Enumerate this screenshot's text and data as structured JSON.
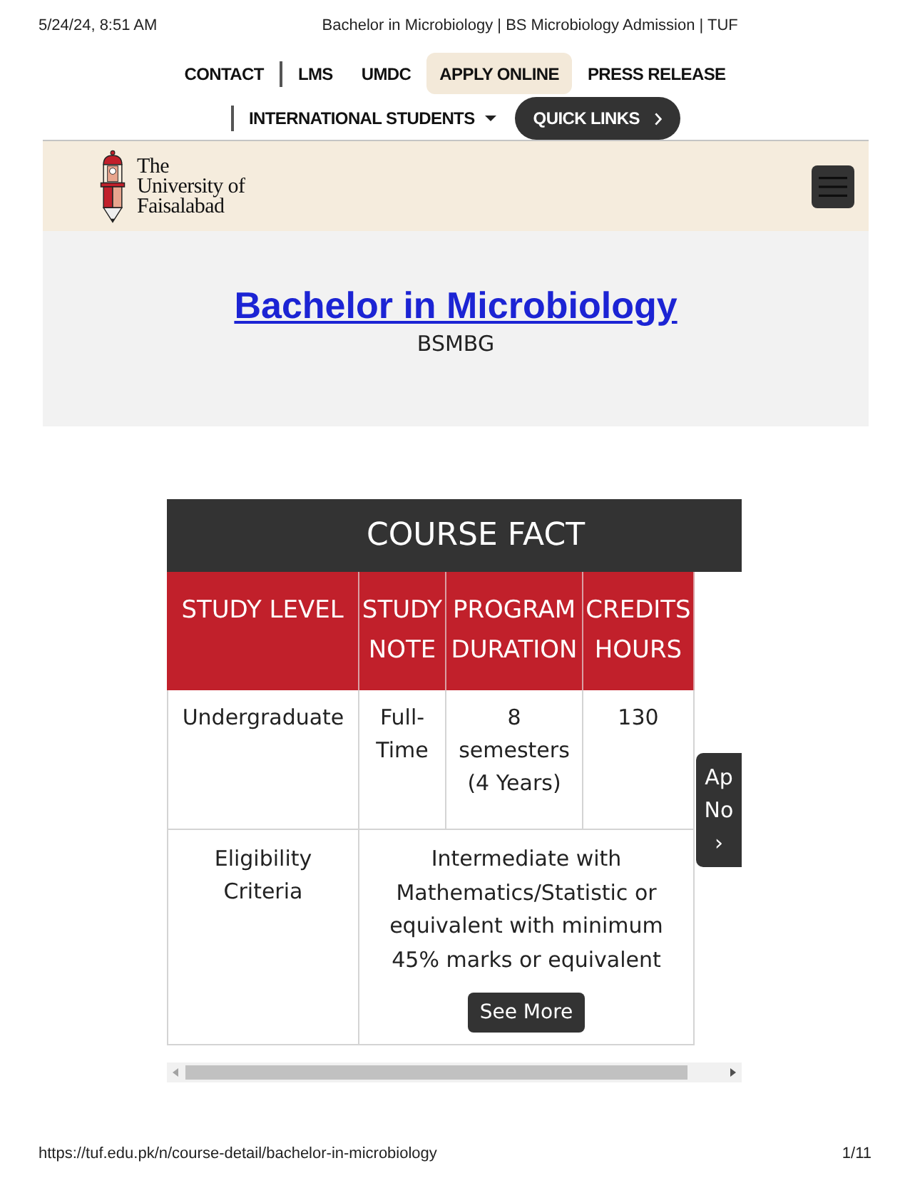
{
  "print_header": {
    "date": "5/24/24, 8:51 AM",
    "title": "Bachelor in Microbiology | BS Microbiology Admission | TUF"
  },
  "nav": {
    "row_1": [
      {
        "label": "CONTACT",
        "separated": false,
        "highlighted": false
      },
      {
        "label": "LMS",
        "separated": true,
        "highlighted": false
      },
      {
        "label": "UMDC",
        "separated": false,
        "highlighted": false
      },
      {
        "label": "APPLY ONLINE",
        "separated": false,
        "highlighted": true
      },
      {
        "label": "PRESS RELEASE",
        "separated": false,
        "highlighted": false
      }
    ],
    "row_2": [
      {
        "label": "INTERNATIONAL STUDENTS",
        "kind": "dropdown",
        "separated": true
      },
      {
        "label": "QUICK LINKS",
        "kind": "pill",
        "separated": false
      }
    ]
  },
  "header": {
    "logo_text": "The University of Faisalabad"
  },
  "hero": {
    "title": "Bachelor in Microbiology",
    "code": "BSMBG"
  },
  "course_fact": {
    "title": "COURSE FACT",
    "columns": [
      "STUDY LEVEL",
      "STUDY NOTE",
      "PROGRAM DURATION",
      "CREDITS HOURS"
    ],
    "rows": [
      {
        "cells": [
          "Undergraduate",
          "Full-Time",
          "8 semesters (4 Years)",
          "130"
        ]
      }
    ],
    "eligibility": {
      "label": "Eligibility Criteria",
      "text": "Intermediate with Mathematics/Statistic or equivalent with minimum 45% marks or equivalent",
      "button": "See More"
    }
  },
  "side_tab": {
    "lines": [
      "Ap",
      "No",
      "›"
    ]
  },
  "print_footer": {
    "url": "https://tuf.edu.pk/n/course-detail/bachelor-in-microbiology",
    "page": "1/11"
  }
}
